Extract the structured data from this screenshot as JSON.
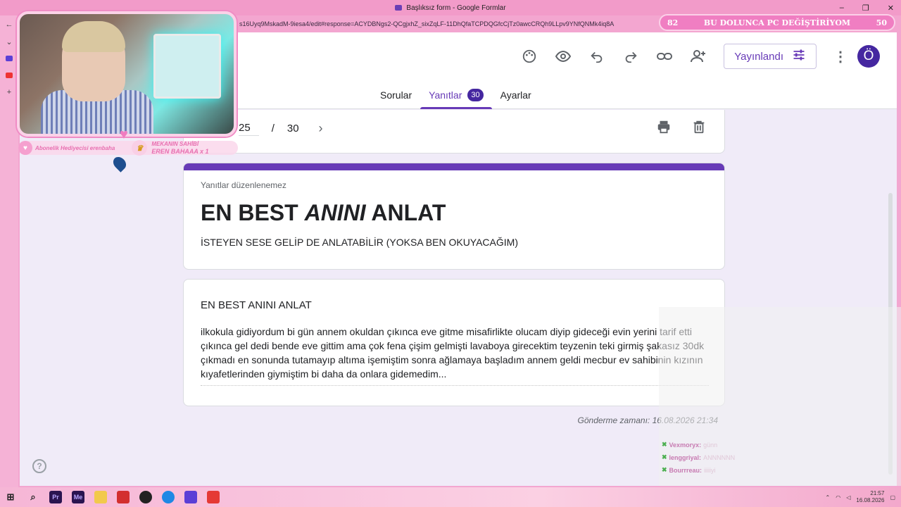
{
  "window": {
    "title": "Başlıksız form - Google Formlar",
    "minimize": "–",
    "maximize": "❐",
    "close": "✕"
  },
  "address": {
    "url": "s16Uyq9MskadM-9iesa4/edit#response=ACYDBNgs2-QCgjxhZ_sixZqLF-11DhQfaTCPDQGfcCjTz0awcCRQh9LLpv9YNfQNMk4iq8A"
  },
  "toolbar": {
    "publish_label": "Yayınlandı",
    "avatar_letter": "Ö",
    "kebab": "⋮"
  },
  "tabs": [
    {
      "label": "Sorular"
    },
    {
      "label": "Yanıtlar",
      "badge": "30"
    },
    {
      "label": "Ayarlar"
    }
  ],
  "navigator": {
    "current": "25",
    "separator": "/",
    "total": "30"
  },
  "form": {
    "note": "Yanıtlar düzenlenemez",
    "title_part1": "EN BEST ",
    "title_part2": "ANINI",
    "title_part3": " ANLAT",
    "description": "İSTEYEN SESE GELİP DE ANLATABİLİR (YOKSA BEN OKUYACAĞIM)"
  },
  "answer": {
    "question": "EN BEST ANINI ANLAT",
    "text": "ilkokula gidiyordum bi gün annem okuldan çıkınca eve gitme misafirlikte olucam diyip gideceği evin yerini tarif etti çıkınca gel dedi bende eve gittim ama çok fena çişim gelmişti lavaboya girecektim teyzenin teki girmiş şakasız 30dk çıkmadı en sonunda tutamayıp altıma işemiştim sonra ağlamaya başladım annem geldi mecbur ev sahibinin kızının kıyafetlerinden giymiştim bi daha da onlara gidemedim..."
  },
  "submitted": "Gönderme zamanı: 16.08.2026 21:34",
  "overlay": {
    "sub_gift": "Abonelik Hediyecisi erenbaha",
    "owner_label": "MEKANIN SAHİBİ",
    "owner_name": "EREN BAHAAA x 1",
    "goal_left": "82",
    "goal_text": "BU DOLUNCA PC DEĞİŞTİRİYOM",
    "goal_right": "50"
  },
  "chat": [
    {
      "user": "Vexmoryx:",
      "msg": "günn"
    },
    {
      "user": "lenggriyal:",
      "msg": "ANNNNNN"
    },
    {
      "user": "Bourrreau:",
      "msg": "iiiiiyi"
    }
  ],
  "taskbar": {
    "time": "21:57",
    "date": "16.08.2026"
  },
  "colors": {
    "accent": "#673ab7",
    "badge": "#4527a0",
    "desktop_pink": "#f3a6d0",
    "goal_pink": "#f07ec2"
  }
}
